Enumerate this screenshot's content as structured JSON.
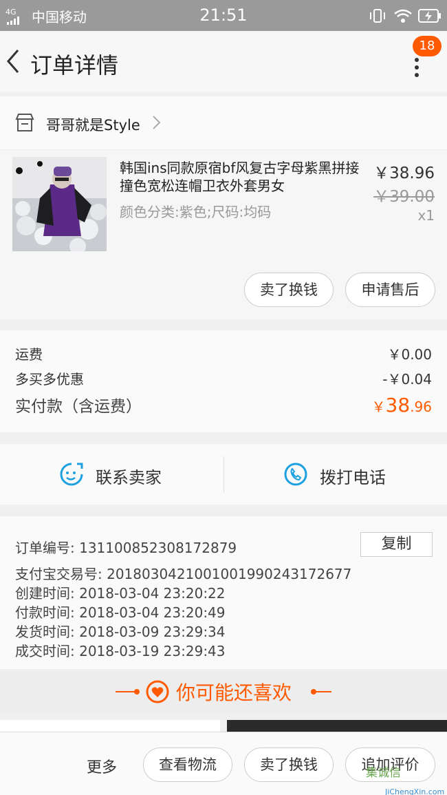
{
  "status_bar": {
    "network": "4G",
    "carrier": "中国移动",
    "time": "21:51"
  },
  "header": {
    "title": "订单详情",
    "badge_count": "18"
  },
  "shop": {
    "name": "哥哥就是Style"
  },
  "product": {
    "title": "韩国ins同款原宿bf风复古字母紫黑拼接撞色宽松连帽卫衣外套男女",
    "spec": "颜色分类:紫色;尺码:均码",
    "price": "￥38.96",
    "original_price": "￥39.00",
    "quantity": "x1",
    "buttons": {
      "sell": "卖了换钱",
      "after_sale": "申请售后"
    }
  },
  "fees": {
    "shipping_label": "运费",
    "shipping_value": "￥0.00",
    "discount_label": "多买多优惠",
    "discount_value": "-￥0.04",
    "paid_label": "实付款（含运费）",
    "paid_currency": "￥",
    "paid_int": "38",
    "paid_dec": ".96"
  },
  "contact": {
    "seller_label": "联系卖家",
    "phone_label": "拨打电话"
  },
  "order_info": {
    "order_no": "订单编号:  131100852308172879",
    "copy_label": "复制",
    "alipay_no": "支付宝交易号:  2018030421001001990243172677",
    "created": "创建时间:  2018-03-04 23:20:22",
    "paid": "付款时间:  2018-03-04 23:20:49",
    "shipped": "发货时间:  2018-03-09 23:29:34",
    "completed": "成交时间:  2018-03-19 23:29:43"
  },
  "recommend": {
    "title": "你可能还喜欢"
  },
  "bottom_bar": {
    "more": "更多",
    "logistics": "查看物流",
    "sell": "卖了换钱",
    "review": "追加评价"
  },
  "watermark": {
    "text": "集诚信",
    "sub": "JiChengXin.com"
  },
  "colors": {
    "accent": "#ff5a00",
    "status_bar": "#9a9a9a",
    "contact_icon": "#1ca0e0"
  }
}
